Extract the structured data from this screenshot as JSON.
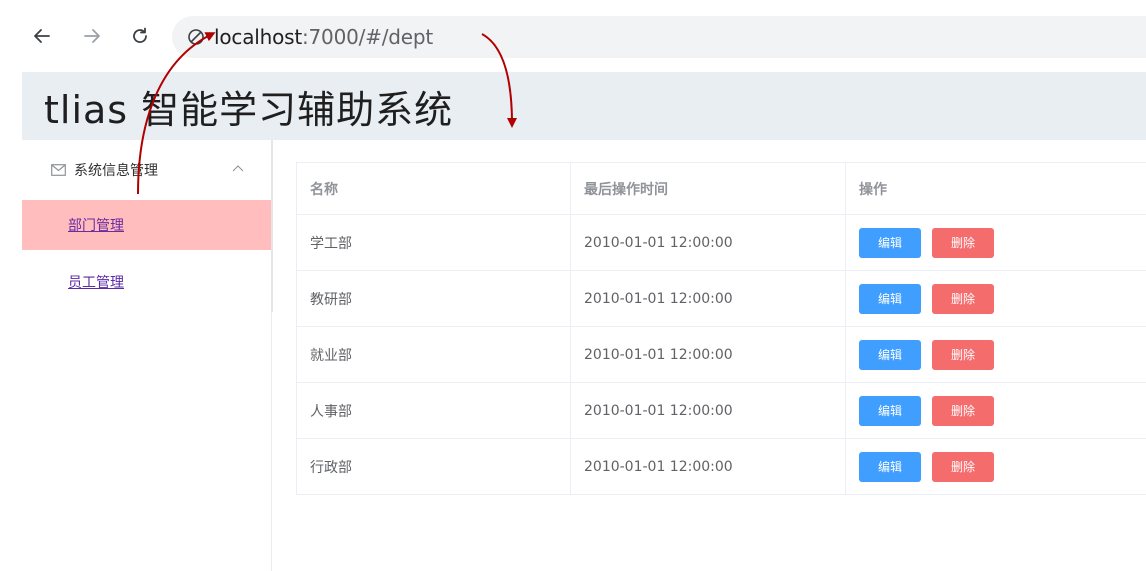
{
  "browser": {
    "nav": {
      "back_icon": "arrow-left-icon",
      "forward_icon": "arrow-right-icon",
      "reload_icon": "reload-icon"
    },
    "url_host": "localhost",
    "url_rest": ":7000/#/dept"
  },
  "header": {
    "title": "tlias 智能学习辅助系统"
  },
  "sidebar": {
    "submenu_label": "系统信息管理",
    "submenu_icon": "mail-icon",
    "chevron_icon": "chevron-up-icon",
    "items": [
      {
        "label": "部门管理",
        "active": true
      },
      {
        "label": "员工管理",
        "active": false
      }
    ],
    "active_color": "#ffbdbd"
  },
  "table": {
    "columns": [
      "名称",
      "最后操作时间",
      "操作"
    ],
    "edit_label": "编辑",
    "delete_label": "删除",
    "rows": [
      {
        "name": "学工部",
        "time": "2010-01-01 12:00:00"
      },
      {
        "name": "教研部",
        "time": "2010-01-01 12:00:00"
      },
      {
        "name": "就业部",
        "time": "2010-01-01 12:00:00"
      },
      {
        "name": "人事部",
        "time": "2010-01-01 12:00:00"
      },
      {
        "name": "行政部",
        "time": "2010-01-01 12:00:00"
      }
    ]
  },
  "colors": {
    "edit_button": "#409eff",
    "delete_button": "#f56c6c",
    "header_bg": "#e9eef3",
    "annotation_arrow": "#b00000"
  }
}
